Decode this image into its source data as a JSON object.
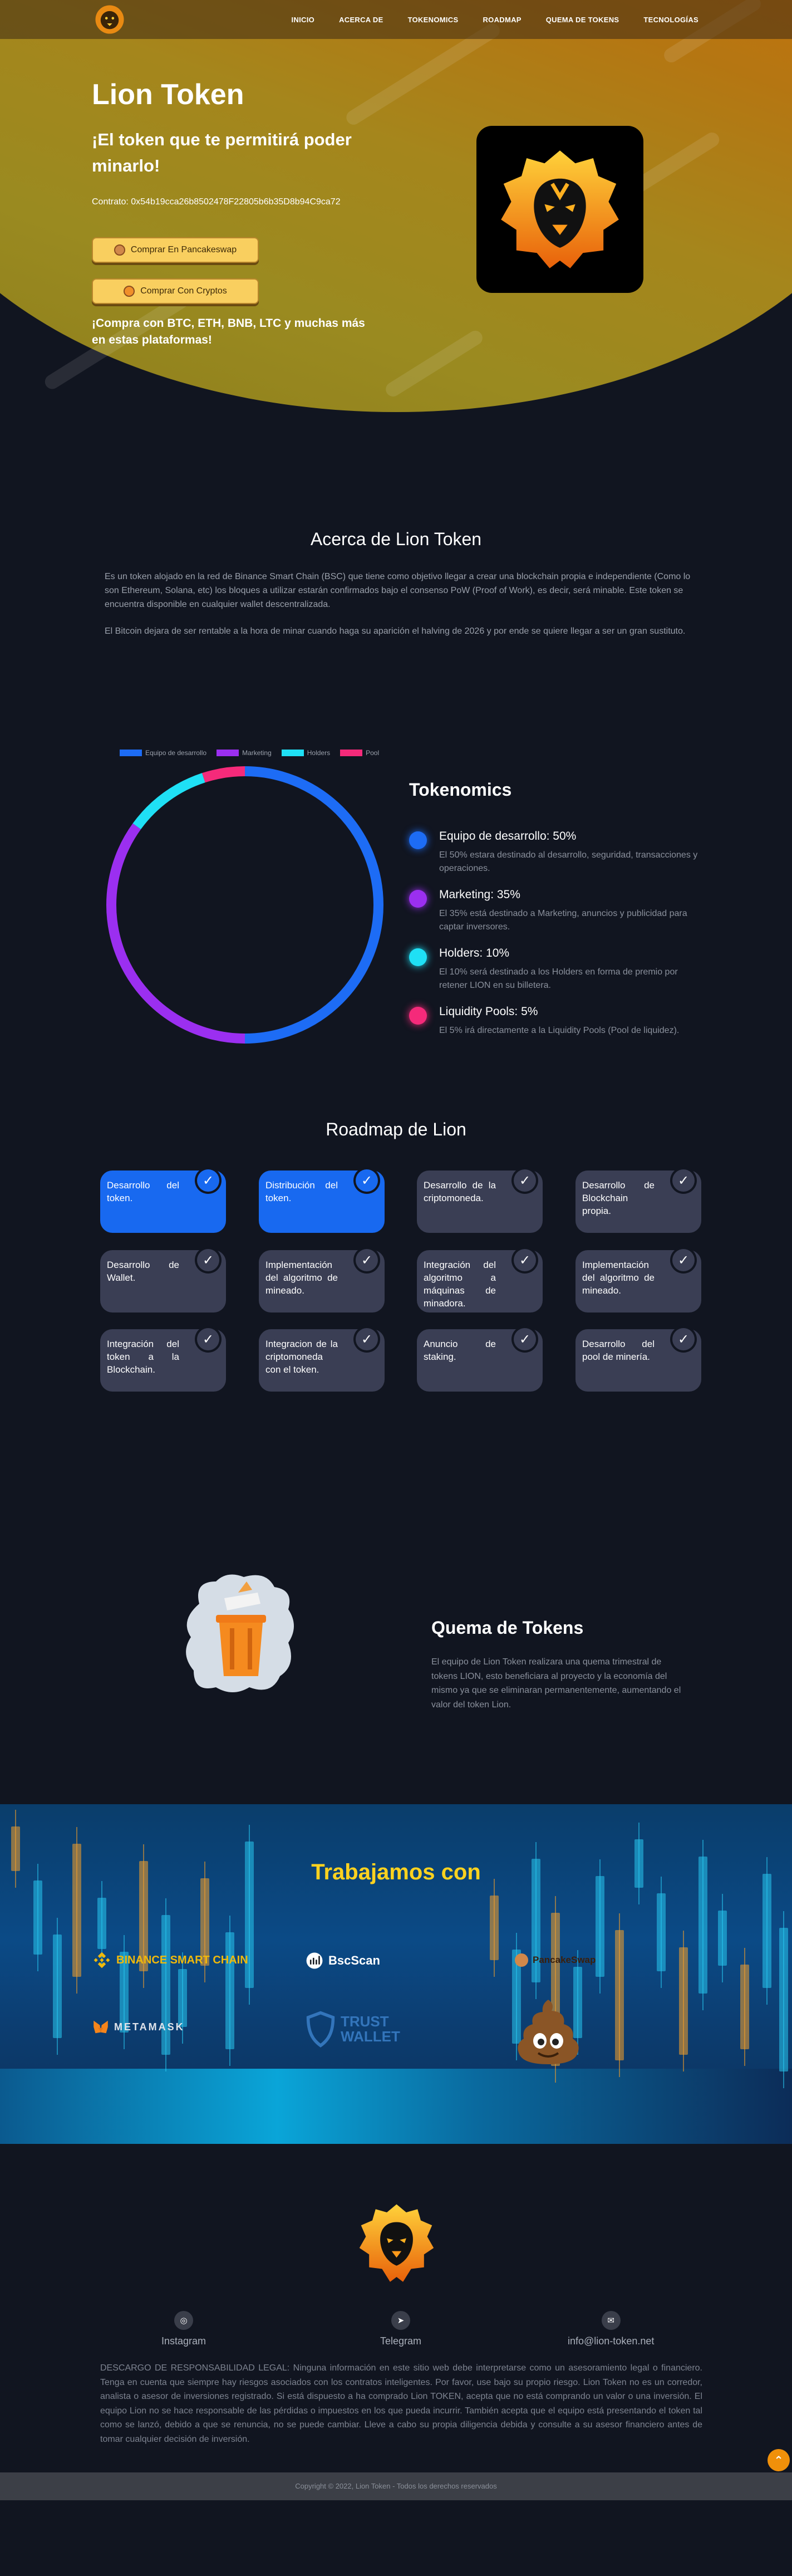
{
  "nav": {
    "links": [
      "INICIO",
      "ACERCA DE",
      "TOKENOMICS",
      "ROADMAP",
      "QUEMA DE TOKENS",
      "TECNOLOGÍAS"
    ]
  },
  "hero": {
    "title": "Lion Token",
    "subtitle": "¡El token que te permitirá poder minarlo!",
    "contract": "Contrato: 0x54b19cca26b8502478F22805b6b35D8b94C9ca72",
    "btn_pancake": "Comprar En Pancakeswap",
    "btn_crypto": "Comprar Con Cryptos",
    "buy_text": "¡Compra con BTC, ETH, BNB, LTC y muchas más en estas plataformas!"
  },
  "about": {
    "title": "Acerca de Lion Token",
    "p1": "Es un token alojado en la red de Binance Smart Chain (BSC) que tiene como objetivo llegar a crear una blockchain propia e independiente (Como lo son Ethereum, Solana, etc) los bloques a utilizar estarán confirmados bajo el consenso PoW (Proof of Work), es decir, será minable. Este token se encuentra disponible en cualquier wallet descentralizada.",
    "p2": "El Bitcoin dejara de ser rentable a la hora de minar cuando haga su aparición el halving de 2026 y por ende se quiere llegar a ser un gran sustituto."
  },
  "tokenomics": {
    "title": "Tokenomics",
    "items": [
      {
        "name": "Equipo de desarrollo: 50%",
        "desc": "El 50% estara destinado al desarrollo, seguridad, transacciones y operaciones.",
        "color": "#1d6cf5"
      },
      {
        "name": "Marketing: 35%",
        "desc": "El 35% está destinado a Marketing, anuncios y publicidad para captar inversores.",
        "color": "#9b2ff0"
      },
      {
        "name": "Holders: 10%",
        "desc": "El 10% será destinado a los Holders en forma de premio por retener LION en su billetera.",
        "color": "#1fe0f5"
      },
      {
        "name": "Liquidity Pools: 5%",
        "desc": "El 5% irá directamente a la Liquidity Pools (Pool de liquidez).",
        "color": "#f52a7a"
      }
    ]
  },
  "chart_data": {
    "type": "pie",
    "categories": [
      "Equipo de desarrollo",
      "Marketing",
      "Holders",
      "Pool"
    ],
    "values": [
      50,
      35,
      10,
      5
    ],
    "colors": [
      "#1d6cf5",
      "#9b2ff0",
      "#1fe0f5",
      "#f52a7a"
    ],
    "legend_position": "top"
  },
  "roadmap": {
    "title": "Roadmap de Lion",
    "items": [
      {
        "label": "Desarrollo del token.",
        "done": true
      },
      {
        "label": "Distribución del token.",
        "done": true
      },
      {
        "label": "Desarrollo de la criptomoneda.",
        "done": false
      },
      {
        "label": "Desarrollo de Blockchain propia.",
        "done": false
      },
      {
        "label": "Desarrollo de Wallet.",
        "done": false
      },
      {
        "label": "Implementación del algoritmo de mineado.",
        "done": false
      },
      {
        "label": "Integración del algoritmo a máquinas de minadora.",
        "done": false
      },
      {
        "label": "Implementación del algoritmo de mineado.",
        "done": false
      },
      {
        "label": "Integración del token a la Blockchain.",
        "done": false
      },
      {
        "label": "Integracion de la criptomoneda con el token.",
        "done": false
      },
      {
        "label": "Anuncio de staking.",
        "done": false
      },
      {
        "label": "Desarrollo del pool de minería.",
        "done": false
      }
    ]
  },
  "quema": {
    "title": "Quema de Tokens",
    "text": "El equipo de Lion Token realizara una quema trimestral de tokens LION, esto beneficiara al proyecto y la economía del mismo ya que se eliminaran permanentemente, aumentando el valor del token Lion."
  },
  "partners": {
    "title": "Trabajamos con",
    "logos": [
      "BINANCE SMART CHAIN",
      "BscScan",
      "PancakeSwap",
      "METAMASK",
      "TRUST WALLET"
    ]
  },
  "footer": {
    "social": [
      {
        "label": "Instagram",
        "icon": "instagram-icon"
      },
      {
        "label": "Telegram",
        "icon": "telegram-icon"
      },
      {
        "label": "info@lion-token.net",
        "icon": "email-icon"
      }
    ],
    "disclaimer": "DESCARGO DE RESPONSABILIDAD LEGAL: Ninguna información en este sitio web debe interpretarse como un asesoramiento legal o financiero. Tenga en cuenta que siempre hay riesgos asociados con los contratos inteligentes. Por favor, use bajo su propio riesgo. Lion Token no es un corredor, analista o asesor de inversiones registrado. Si está dispuesto a ha comprado Lion TOKEN, acepta que no está comprando un valor o una inversión. El equipo Lion no se hace responsable de las pérdidas o impuestos en los que pueda incurrir. También acepta que el equipo está presentando el token tal como se lanzó, debido a que se renuncia, no se puede cambiar. Lleve a cabo su propia diligencia debida y consulte a su asesor financiero antes de tomar cualquier decisión de inversión.",
    "copyright": "Copyright © 2022, Lion Token - Todos los derechos reservados"
  },
  "colors": {
    "accent": "#1869f0",
    "gold": "#f9cf5f",
    "background": "#111520"
  }
}
